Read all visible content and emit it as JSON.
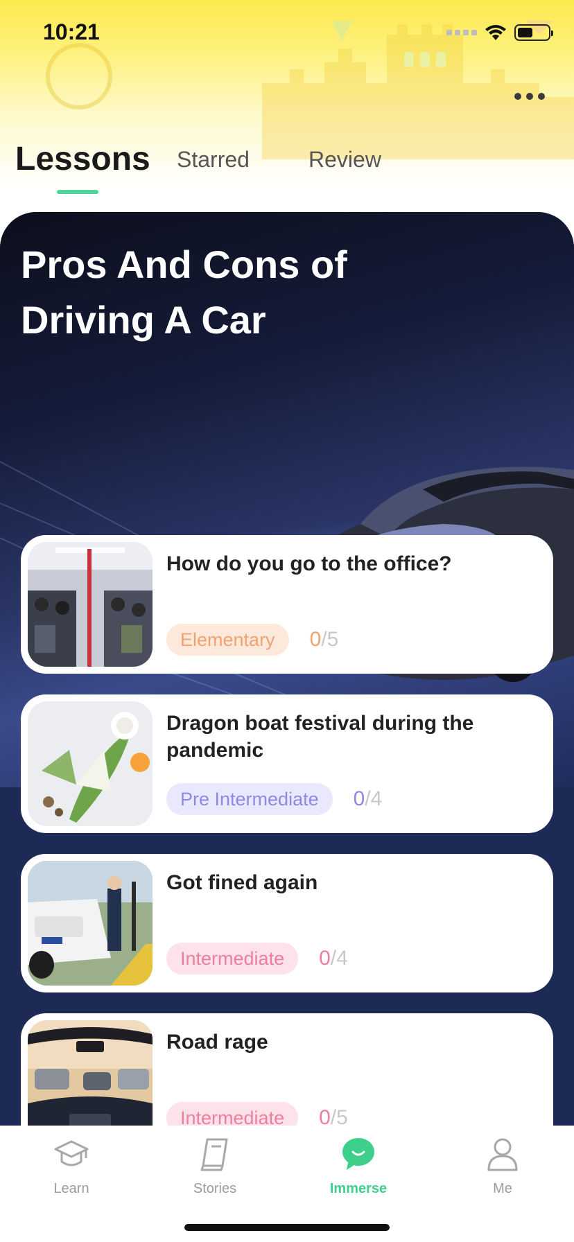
{
  "status_bar": {
    "time": "10:21"
  },
  "header": {
    "more_icon": "more-horizontal-icon",
    "tabs": [
      {
        "label": "Lessons",
        "active": true
      },
      {
        "label": "Starred",
        "active": false
      },
      {
        "label": "Review",
        "active": false
      }
    ],
    "accent_color": "#4fd49a"
  },
  "hero": {
    "title": "Pros And Cons of Driving A Car"
  },
  "lessons": [
    {
      "title": "How do you go to the office?",
      "level": "Elementary",
      "done": "0",
      "total": "/5",
      "level_color": "#f0a36e"
    },
    {
      "title": "Dragon boat festival during the pandemic",
      "level": "Pre Intermediate",
      "done": "0",
      "total": "/4",
      "level_color": "#8f89e6"
    },
    {
      "title": "Got fined again",
      "level": "Intermediate",
      "done": "0",
      "total": "/4",
      "level_color": "#ec7ea0"
    },
    {
      "title": "Road rage",
      "level": "Intermediate",
      "done": "0",
      "total": "/5",
      "level_color": "#ec7ea0"
    }
  ],
  "bottom_nav": {
    "items": [
      {
        "label": "Learn",
        "icon": "graduation-cap-icon",
        "active": false
      },
      {
        "label": "Stories",
        "icon": "book-icon",
        "active": false
      },
      {
        "label": "Immerse",
        "icon": "chat-bubble-icon",
        "active": true
      },
      {
        "label": "Me",
        "icon": "person-icon",
        "active": false
      }
    ],
    "active_color": "#3fcf8c"
  }
}
